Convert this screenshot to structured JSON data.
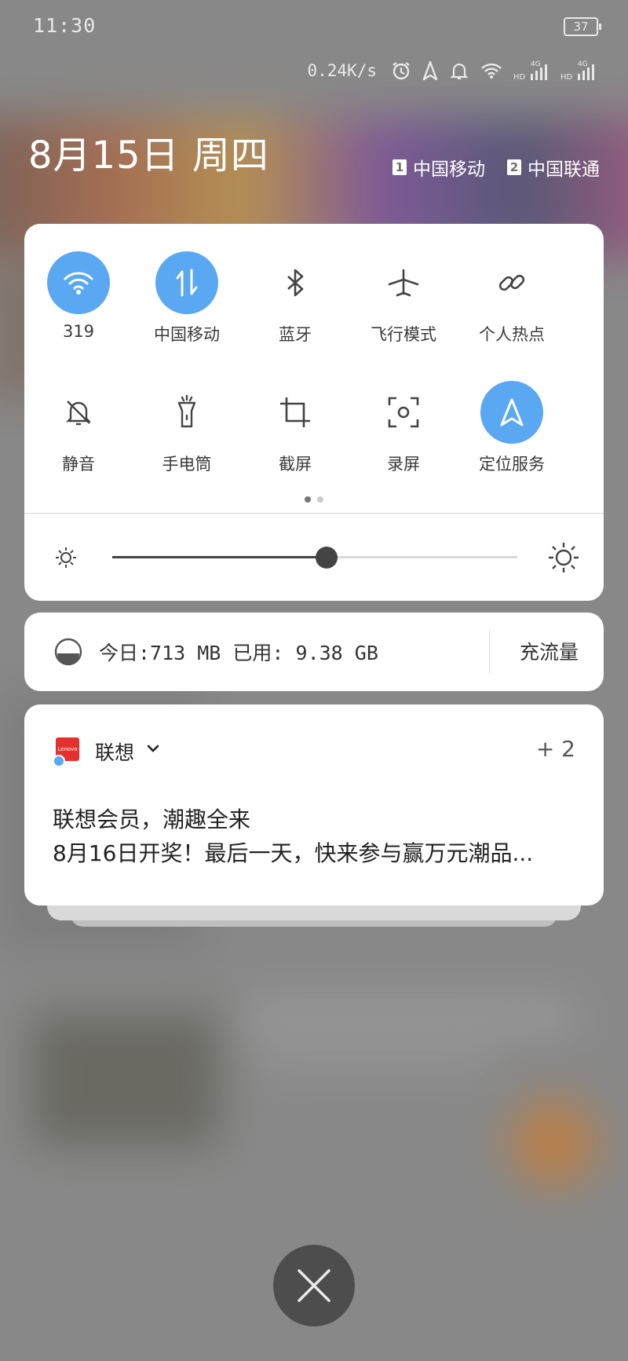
{
  "status_bar": {
    "time": "11:30",
    "battery": "37",
    "net_speed": "0.24K/s",
    "icons": [
      "alarm-icon",
      "location-icon",
      "bell-icon",
      "wifi-icon",
      "signal-sim1-icon",
      "signal-sim2-icon"
    ]
  },
  "header": {
    "date": "8月15日 周四",
    "sim1": {
      "num": "1",
      "carrier": "中国移动"
    },
    "sim2": {
      "num": "2",
      "carrier": "中国联通"
    }
  },
  "quick_settings": {
    "accent": "#5aa7f2",
    "tiles": [
      {
        "name": "wifi",
        "label": "319",
        "active": true,
        "icon": "wifi-icon"
      },
      {
        "name": "mobile-data",
        "label": "中国移动",
        "active": true,
        "icon": "mobile-data-icon"
      },
      {
        "name": "bluetooth",
        "label": "蓝牙",
        "active": false,
        "icon": "bluetooth-icon"
      },
      {
        "name": "airplane",
        "label": "飞行模式",
        "active": false,
        "icon": "airplane-icon"
      },
      {
        "name": "hotspot",
        "label": "个人热点",
        "active": false,
        "icon": "link-icon"
      },
      {
        "name": "mute",
        "label": "静音",
        "active": false,
        "icon": "mute-bell-icon"
      },
      {
        "name": "flashlight",
        "label": "手电筒",
        "active": false,
        "icon": "flashlight-icon"
      },
      {
        "name": "screenshot",
        "label": "截屏",
        "active": false,
        "icon": "crop-icon"
      },
      {
        "name": "screen-record",
        "label": "录屏",
        "active": false,
        "icon": "record-icon"
      },
      {
        "name": "location",
        "label": "定位服务",
        "active": true,
        "icon": "location-arrow-icon"
      }
    ],
    "page_count": 2,
    "current_page": 1,
    "brightness": 0.53
  },
  "data_usage": {
    "text": "今日:713 MB  已用: 9.38 GB",
    "button": "充流量"
  },
  "notification": {
    "app_icon_text": "Lenovo",
    "app": "联想",
    "count": "+ 2",
    "title": "联想会员，潮趣全来",
    "body": "8月16日开奖！最后一天，快来参与赢万元潮品..."
  }
}
